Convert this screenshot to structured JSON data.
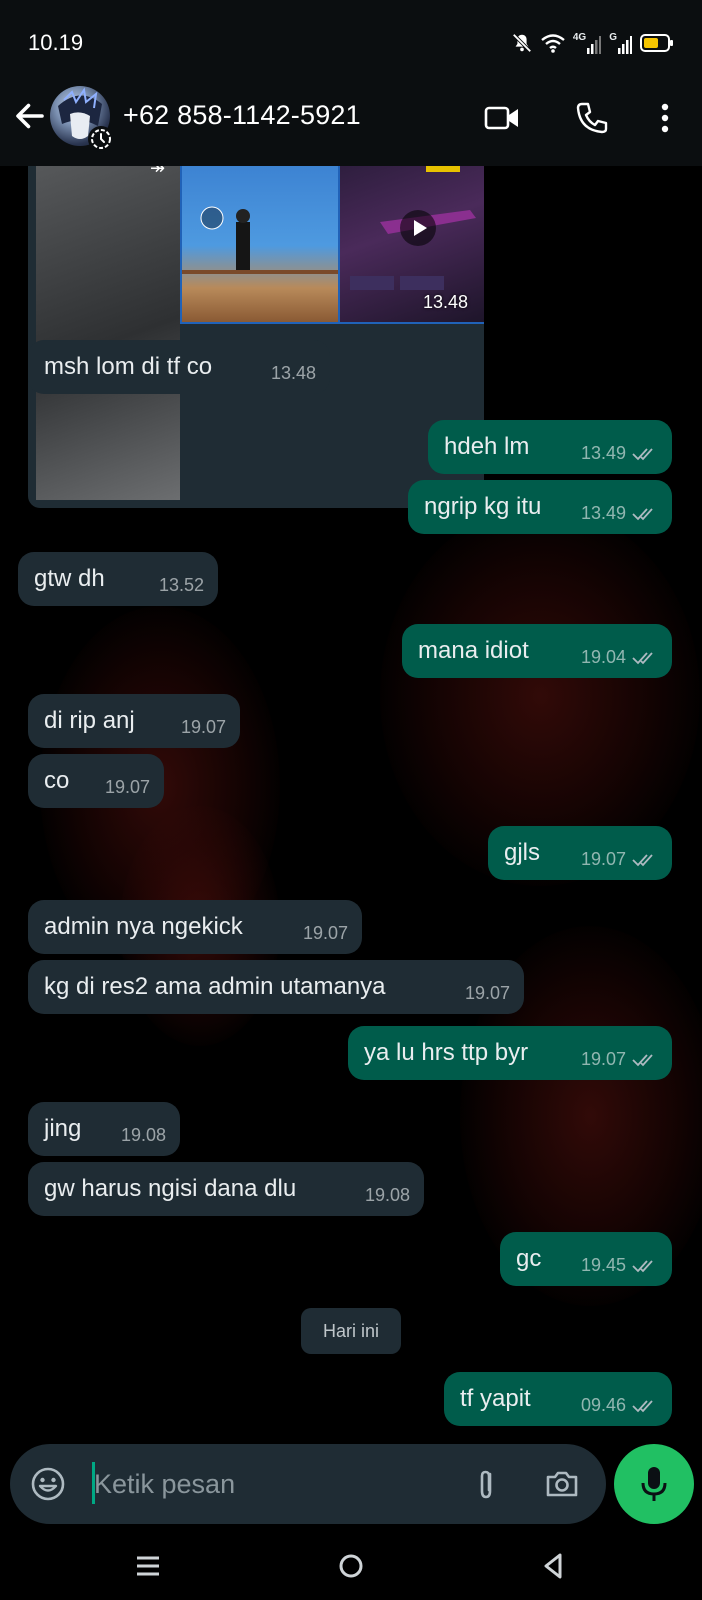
{
  "status_bar": {
    "time": "10.19",
    "net1": "4G",
    "net2": "G",
    "icons": [
      "bell-muted-icon",
      "wifi-icon",
      "signal-4g-icon",
      "signal-g-icon",
      "battery-icon"
    ]
  },
  "header": {
    "contact_name": "+62 858-1142-5921",
    "icons": [
      "back-arrow-icon",
      "video-call-icon",
      "phone-icon",
      "more-vert-icon"
    ]
  },
  "media_message": {
    "time": "13.48",
    "forwarded_icon": "forward-icon"
  },
  "messages": [
    {
      "dir": "in",
      "text": "msh lom di tf co",
      "time": "13.48"
    },
    {
      "dir": "out",
      "text": "hdeh lm",
      "time": "13.49"
    },
    {
      "dir": "out",
      "text": "ngrip kg itu",
      "time": "13.49"
    },
    {
      "dir": "in",
      "text": "gtw dh",
      "time": "13.52"
    },
    {
      "dir": "out",
      "text": "mana idiot",
      "time": "19.04"
    },
    {
      "dir": "in",
      "text": "di rip anj",
      "time": "19.07"
    },
    {
      "dir": "in",
      "text": "co",
      "time": "19.07"
    },
    {
      "dir": "out",
      "text": "gjls",
      "time": "19.07"
    },
    {
      "dir": "in",
      "text": "admin nya ngekick",
      "time": "19.07"
    },
    {
      "dir": "in",
      "text": "kg di res2 ama admin utamanya",
      "time": "19.07"
    },
    {
      "dir": "out",
      "text": "ya lu hrs ttp byr",
      "time": "19.07"
    },
    {
      "dir": "in",
      "text": "jing",
      "time": "19.08"
    },
    {
      "dir": "in",
      "text": "gw harus ngisi dana dlu",
      "time": "19.08"
    },
    {
      "dir": "out",
      "text": "gc",
      "time": "19.45"
    },
    {
      "dir": "out",
      "text": "tf yapit",
      "time": "09.46"
    }
  ],
  "date_divider": "Hari ini",
  "composer": {
    "placeholder": "Ketik pesan",
    "icons": [
      "emoji-icon",
      "attach-icon",
      "camera-icon",
      "mic-icon"
    ]
  },
  "colors": {
    "incoming_bubble": "#1f2c34",
    "outgoing_bubble": "#005c4b",
    "accent": "#21c063"
  }
}
